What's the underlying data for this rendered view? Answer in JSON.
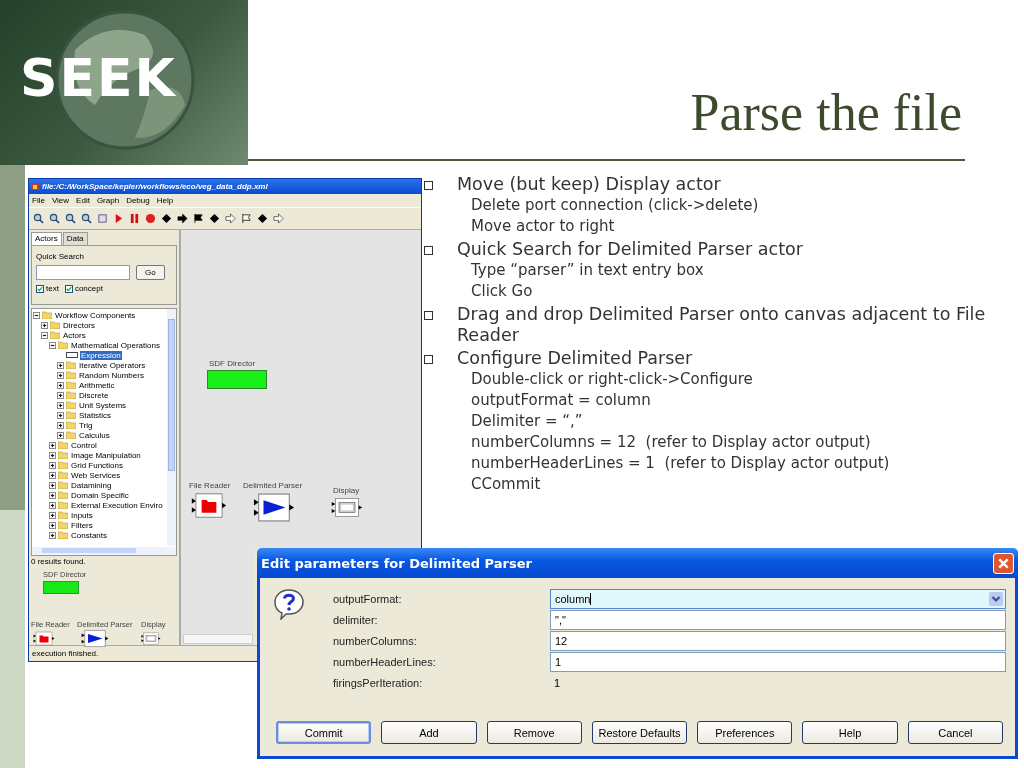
{
  "logo": {
    "text": "SEEK"
  },
  "title": "Parse the file",
  "bullets": [
    {
      "text": "Move (but keep) Display actor",
      "children": [
        "Delete port connection (click->delete)",
        "Move actor to right"
      ]
    },
    {
      "text": "Quick Search for Delimited Parser actor",
      "children": [
        "Type “parser” in text entry box",
        "Click Go"
      ]
    },
    {
      "text": "Drag and drop Delimited Parser onto canvas adjacent to File Reader"
    },
    {
      "text": "Configure Delimited Parser",
      "children": [
        "Double-click or right-click->Configure",
        "outputFormat = column",
        "Delimiter = “,”",
        "numberColumns = 12  (refer to Display actor output)",
        "numberHeaderLines = 1  (refer to Display actor output)",
        "CCommit"
      ]
    }
  ],
  "kepler_window": {
    "title": "file:/C:/WorkSpace/kepler/workflows/eco/veg_data_ddp.xml",
    "menu": [
      "File",
      "View",
      "Edit",
      "Graph",
      "Debug",
      "Help"
    ],
    "tabs": [
      {
        "label": "Actors",
        "selected": true
      },
      {
        "label": "Data",
        "selected": false
      }
    ],
    "quick_search": {
      "label": "Quick Search",
      "button": "Go",
      "checkboxes": [
        {
          "label": "text",
          "checked": true
        },
        {
          "label": "concept",
          "checked": true
        }
      ]
    },
    "tree": [
      {
        "label": "Workflow Components",
        "kind": "folder",
        "expanded": true,
        "selected": false,
        "children": [
          {
            "label": "Directors",
            "kind": "folder",
            "expanded": false,
            "selected": false
          },
          {
            "label": "Actors",
            "kind": "folder",
            "expanded": true,
            "selected": false,
            "children": [
              {
                "label": "Mathematical Operations",
                "kind": "folder",
                "expanded": true,
                "selected": false,
                "children": [
                  {
                    "label": "Expression",
                    "kind": "leaf",
                    "selected": true
                  },
                  {
                    "label": "Iterative Operators",
                    "kind": "folder",
                    "expanded": false,
                    "selected": false
                  },
                  {
                    "label": "Random Numbers",
                    "kind": "folder",
                    "expanded": false,
                    "selected": false
                  },
                  {
                    "label": "Arithmetic",
                    "kind": "folder",
                    "expanded": false,
                    "selected": false
                  },
                  {
                    "label": "Discrete",
                    "kind": "folder",
                    "expanded": false,
                    "selected": false
                  },
                  {
                    "label": "Unit Systems",
                    "kind": "folder",
                    "expanded": false,
                    "selected": false
                  },
                  {
                    "label": "Statistics",
                    "kind": "folder",
                    "expanded": false,
                    "selected": false
                  },
                  {
                    "label": "Trig",
                    "kind": "folder",
                    "expanded": false,
                    "selected": false
                  },
                  {
                    "label": "Calculus",
                    "kind": "folder",
                    "expanded": false,
                    "selected": false
                  }
                ]
              },
              {
                "label": "Control",
                "kind": "folder",
                "expanded": false,
                "selected": false
              },
              {
                "label": "Image Manipulation",
                "kind": "folder",
                "expanded": false,
                "selected": false
              },
              {
                "label": "Grid Functions",
                "kind": "folder",
                "expanded": false,
                "selected": false
              },
              {
                "label": "Web Services",
                "kind": "folder",
                "expanded": false,
                "selected": false
              },
              {
                "label": "Datamining",
                "kind": "folder",
                "expanded": false,
                "selected": false
              },
              {
                "label": "Domain Specific",
                "kind": "folder",
                "expanded": false,
                "selected": false
              },
              {
                "label": "External Execution Enviro",
                "kind": "folder",
                "expanded": false,
                "selected": false
              },
              {
                "label": "Inputs",
                "kind": "folder",
                "expanded": false,
                "selected": false
              },
              {
                "label": "Filters",
                "kind": "folder",
                "expanded": false,
                "selected": false
              },
              {
                "label": "Constants",
                "kind": "folder",
                "expanded": false,
                "selected": false
              }
            ]
          }
        ]
      }
    ],
    "results": "0 results found.",
    "canvas": {
      "director": "SDF Director",
      "actors": [
        {
          "label": "File Reader",
          "kind": "reader"
        },
        {
          "label": "Delimited Parser",
          "kind": "parser"
        },
        {
          "label": "Display",
          "kind": "display"
        }
      ]
    },
    "overview": {
      "director": "SDF Director",
      "actors": [
        {
          "label": "File Reader",
          "kind": "reader"
        },
        {
          "label": "Delimited Parser",
          "kind": "parser"
        },
        {
          "label": "Display",
          "kind": "display"
        }
      ]
    },
    "status": "execution finished."
  },
  "dialog": {
    "title": "Edit parameters for Delimited Parser",
    "params": [
      {
        "label": "outputFormat:",
        "value": "column",
        "kind": "combo",
        "focused": true
      },
      {
        "label": "delimiter:",
        "value": "\",\"",
        "kind": "text",
        "focused": false
      },
      {
        "label": "numberColumns:",
        "value": "12",
        "kind": "text",
        "focused": false
      },
      {
        "label": "numberHeaderLines:",
        "value": "1",
        "kind": "text",
        "focused": false
      },
      {
        "label": "firingsPerIteration:",
        "value": "1",
        "kind": "static",
        "focused": false
      }
    ],
    "buttons": [
      {
        "label": "Commit",
        "focused": true
      },
      {
        "label": "Add",
        "focused": false
      },
      {
        "label": "Remove",
        "focused": false
      },
      {
        "label": "Restore Defaults",
        "focused": false
      },
      {
        "label": "Preferences",
        "focused": false
      },
      {
        "label": "Help",
        "focused": false
      },
      {
        "label": "Cancel",
        "focused": false
      }
    ]
  }
}
